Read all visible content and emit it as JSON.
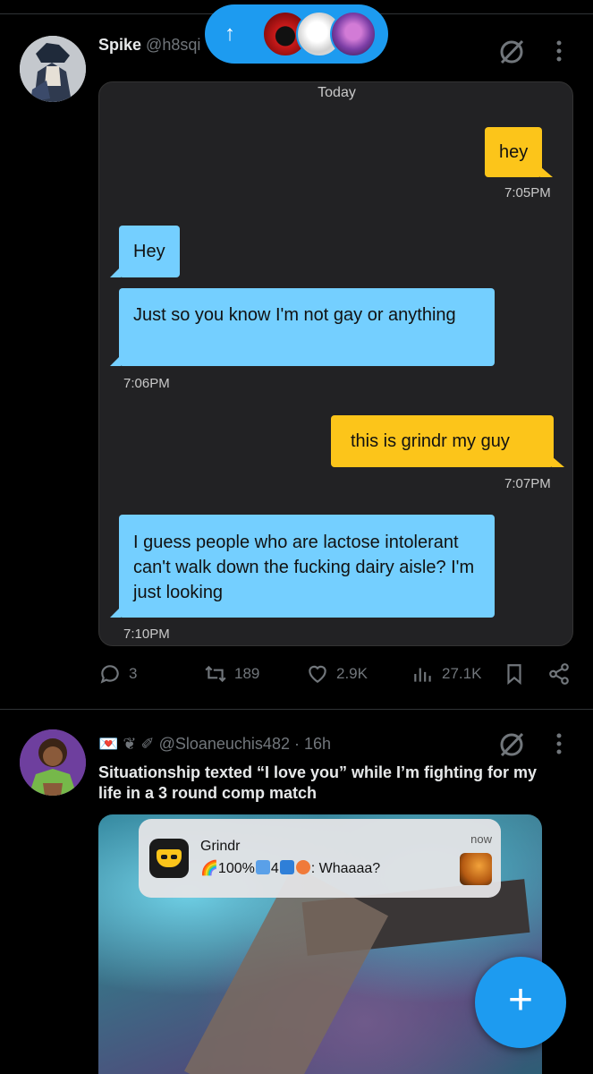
{
  "new_posts_pill": {
    "arrow": "↑",
    "avatars": [
      "avatar-1",
      "avatar-2",
      "avatar-3"
    ]
  },
  "post1": {
    "display_name": "Spike",
    "handle": "@h8sqi",
    "image": {
      "day_label": "Today",
      "messages": [
        {
          "side": "right",
          "text": "hey"
        },
        {
          "side": "left",
          "text": "Hey"
        },
        {
          "side": "left",
          "text": "Just so you know I'm not gay or anything"
        },
        {
          "side": "right",
          "text": "this is grindr my guy"
        },
        {
          "side": "left",
          "text": "I guess people who are lactose intolerant can't walk down the fucking dairy aisle? I'm just looking"
        }
      ],
      "times": [
        "7:05PM",
        "7:06PM",
        "7:07PM",
        "7:10PM"
      ],
      "colors": {
        "outgoing": "#fcc51a",
        "incoming": "#74cfff"
      }
    },
    "stats": {
      "replies": "3",
      "reposts": "189",
      "likes": "2.9K",
      "views": "27.1K"
    }
  },
  "post2": {
    "handle_line": "@Sloaneuchis482 · 16h",
    "emoji_prefix": "💌 ❦ ✐",
    "text": "Situationship texted “I love you” while I’m fighting for my life in a 3 round comp match",
    "notification": {
      "app": "Grindr",
      "time": "now",
      "message_text": "100%",
      "count": "4",
      "suffix": ": Whaaaa?"
    }
  },
  "fab": {
    "icon": "plus-icon",
    "label": "+"
  },
  "accent": "#1d9bf0"
}
